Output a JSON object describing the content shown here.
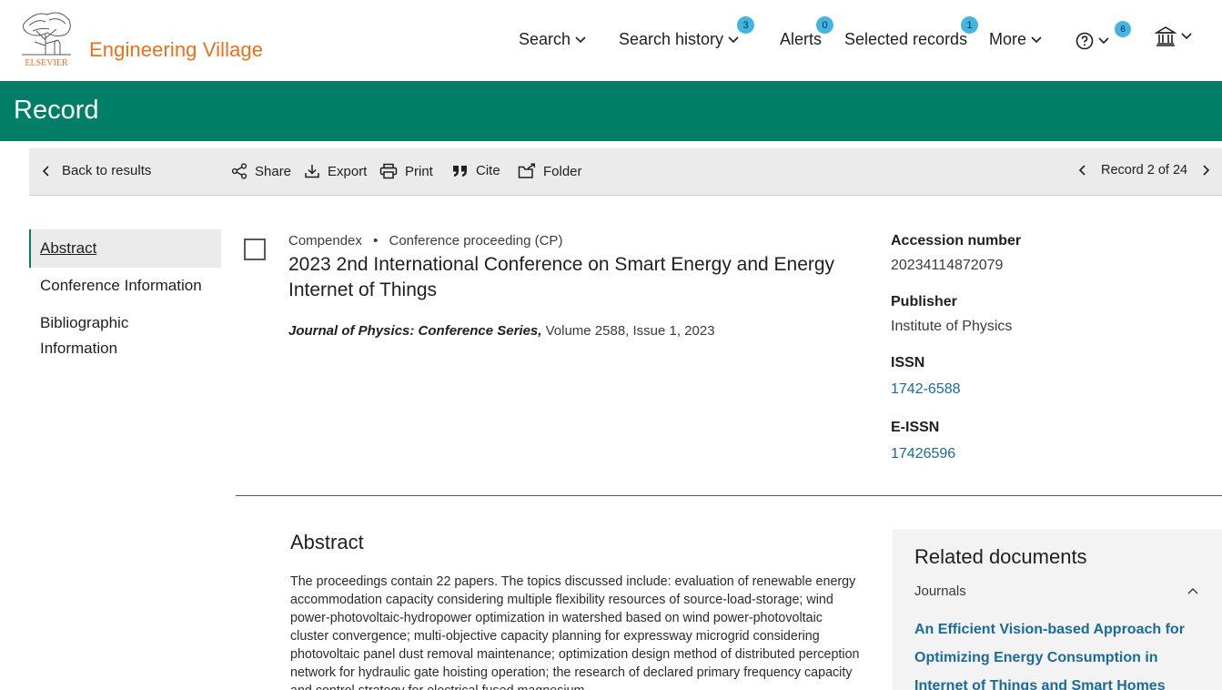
{
  "header": {
    "publisher_logo_text": "ELSEVIER",
    "brand": "Engineering Village",
    "nav": {
      "search": "Search",
      "search_history": "Search history",
      "search_history_count": "3",
      "alerts": "Alerts",
      "alerts_count": "0",
      "selected_records": "Selected records",
      "selected_records_count": "1",
      "more": "More",
      "help_count": "6"
    }
  },
  "band": {
    "title": "Record"
  },
  "toolbar": {
    "back": "Back to results",
    "share": "Share",
    "export": "Export",
    "print": "Print",
    "cite": "Cite",
    "folder": "Folder",
    "record_position": "Record 2 of 24"
  },
  "leftnav": {
    "items": [
      "Abstract",
      "Conference Information",
      "Bibliographic",
      "Information"
    ]
  },
  "record": {
    "database": "Compendex",
    "doc_type": "Conference proceeding (CP)",
    "title": "2023 2nd International Conference on Smart Energy and Energy Internet of Things",
    "journal": "Journal of Physics: Conference Series,",
    "volume_info": " Volume 2588, Issue 1, 2023"
  },
  "meta": {
    "accession_label": "Accession number",
    "accession_value": "20234114872079",
    "publisher_label": "Publisher",
    "publisher_value": "Institute of Physics",
    "issn_label": "ISSN",
    "issn_value": "1742-6588",
    "eissn_label": "E-ISSN",
    "eissn_value": "17426596"
  },
  "abstract": {
    "heading": "Abstract",
    "text": "The proceedings contain 22 papers. The topics discussed include: evaluation of renewable energy accommodation capacity considering multiple flexibility resources of source-load-storage; wind power-photovoltaic-hydropower optimization in watershed based on wind power-photovoltaic cluster convergence; multi-objective capacity planning for expressway microgrid considering photovoltaic panel dust removal maintenance; optimization design method of distributed perception network for hydraulic gate hoisting operation; the research of declared primary frequency capacity and control strategy for electrical fused magnesium"
  },
  "related": {
    "heading": "Related documents",
    "subheading": "Journals",
    "link": "An Efficient Vision-based Approach for Optimizing Energy Consumption in Internet of Things and Smart Homes"
  },
  "colors": {
    "brand_orange": "#e9711c",
    "band_green": "#007e68",
    "badge_blue": "#44b5e3",
    "link_blue": "#1a6b99"
  }
}
